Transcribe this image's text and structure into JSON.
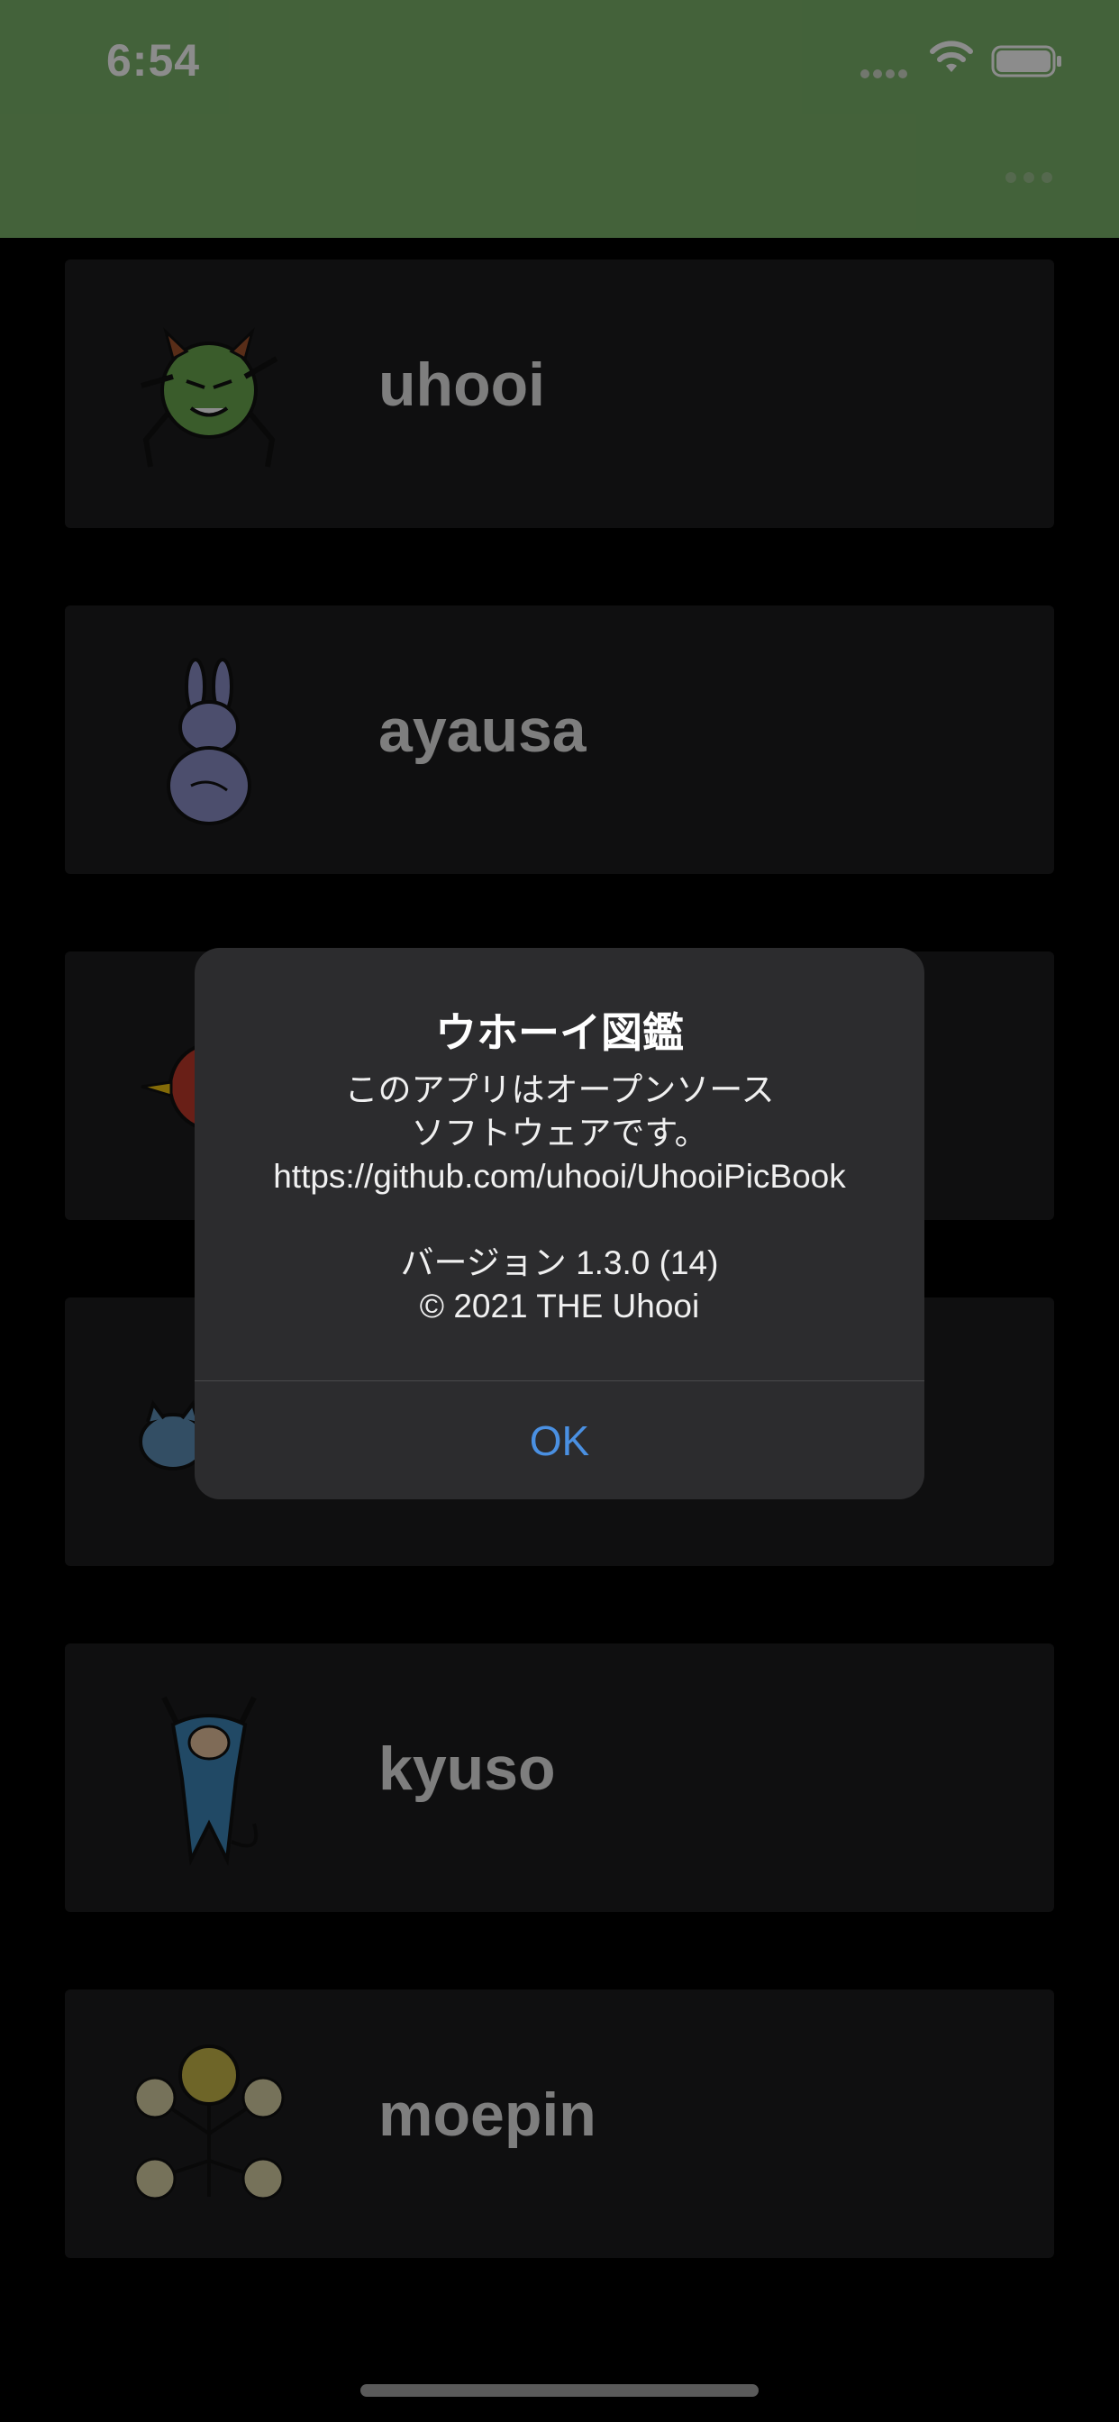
{
  "status": {
    "time": "6:54"
  },
  "header": {
    "menu_icon": "ellipsis-icon",
    "color": "#7bb26a"
  },
  "list": {
    "items": [
      {
        "name": "uhooi"
      },
      {
        "name": "ayausa"
      },
      {
        "name": ""
      },
      {
        "name": ""
      },
      {
        "name": "kyuso"
      },
      {
        "name": "moepin"
      }
    ]
  },
  "alert": {
    "title": "ウホーイ図鑑",
    "line1": "このアプリはオープンソース",
    "line2": "ソフトウェアです。",
    "line3": "https://github.com/uhooi/UhooiPicBook",
    "version": "バージョン 1.3.0 (14)",
    "copyright": "© 2021 THE Uhooi",
    "ok_label": "OK"
  },
  "colors": {
    "accent": "#4a90e2",
    "alert_bg": "#2c2c2e"
  }
}
